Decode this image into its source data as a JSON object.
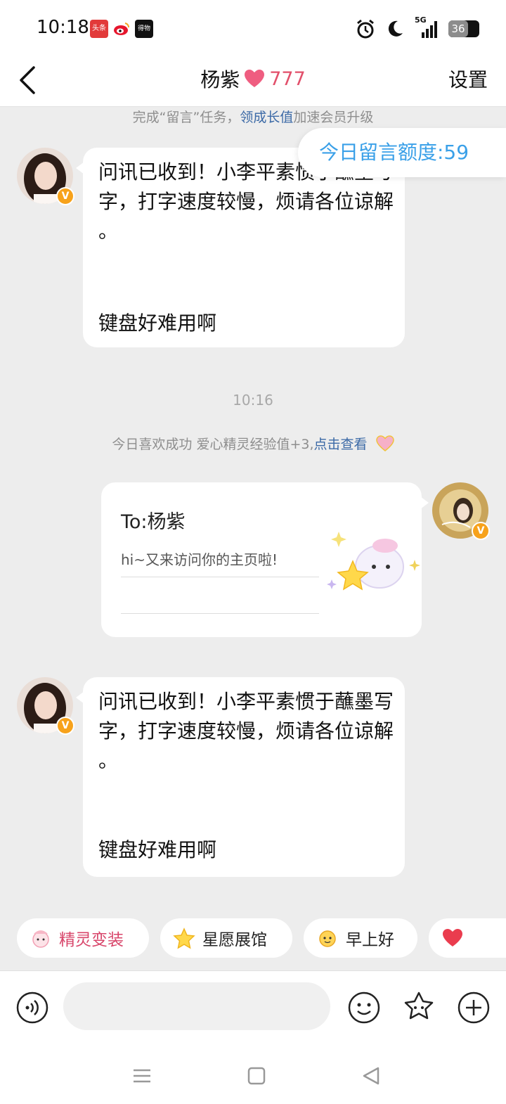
{
  "status_bar": {
    "time": "10:18",
    "apps": [
      "头条",
      "微博",
      "得物"
    ],
    "network": "5G",
    "battery": "36",
    "battery_level_percent": 36
  },
  "header": {
    "title": "杨紫",
    "heart_count": "777",
    "settings_label": "设置"
  },
  "top_hint": {
    "prefix": "完成“留言”任务，",
    "link": "领成长值",
    "suffix": "加速会员升级"
  },
  "quota_label": "今日留言额度:59",
  "messages": [
    {
      "text": "问讯已收到！小李平素惯于蘸墨写字，打字速度较慢，烦请各位谅解 。",
      "footer": "键盘好难用啊"
    },
    {
      "text": "问讯已收到！小李平素惯于蘸墨写字，打字速度较慢，烦请各位谅解 。",
      "footer": "键盘好难用啊"
    }
  ],
  "timestamp": "10:16",
  "like_hint": {
    "prefix": "今日喜欢成功 爱心精灵经验值+3,",
    "link": "点击查看"
  },
  "card": {
    "to": "To:杨紫",
    "message": "hi~又来访问你的主页啦!"
  },
  "chips": [
    {
      "label": "精灵变装",
      "icon": "sprite-icon"
    },
    {
      "label": "星愿展馆",
      "icon": "star-icon"
    },
    {
      "label": "早上好",
      "icon": "sun-face-icon"
    },
    {
      "label": "",
      "icon": "heart-icon"
    }
  ],
  "colors": {
    "accent_blue": "#3aa0e8",
    "link_blue": "#3b69a6",
    "heart_pink": "#e2506b",
    "verified_orange": "#f7a21b",
    "background": "#ededed"
  }
}
